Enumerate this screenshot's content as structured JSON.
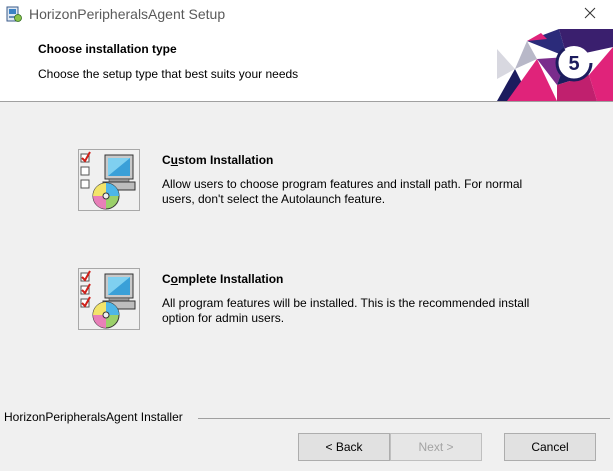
{
  "window": {
    "title": "HorizonPeripheralsAgent Setup",
    "app_icon": "installer-icon",
    "close_icon": "close-icon"
  },
  "banner": {
    "title": "Choose installation type",
    "subtitle": "Choose the setup type that best suits your needs",
    "art": "horizon-logo-art"
  },
  "options": [
    {
      "title_prefix": "C",
      "title_underlined": "u",
      "title_rest": "stom Installation",
      "description": "Allow users to choose program features and install path. For normal users, don't select the Autolaunch feature.",
      "icon": "custom-install-icon"
    },
    {
      "title_prefix": "C",
      "title_underlined": "o",
      "title_rest": "mplete Installation",
      "description": "All program features will be installed. This is the recommended install option for admin users.",
      "icon": "complete-install-icon"
    }
  ],
  "footer": {
    "label": "HorizonPeripheralsAgent Installer"
  },
  "buttons": {
    "back": "< Back",
    "next": "Next >",
    "cancel": "Cancel",
    "next_enabled": false
  },
  "colors": {
    "background": "#f0f0f0",
    "banner_bg": "#ffffff",
    "button_bg": "#e1e1e1",
    "button_border": "#adadad",
    "disabled_text": "#a3a3a3",
    "check_red": "#d0201a",
    "art_navy": "#1c1c5e",
    "art_pink": "#e0237a"
  }
}
